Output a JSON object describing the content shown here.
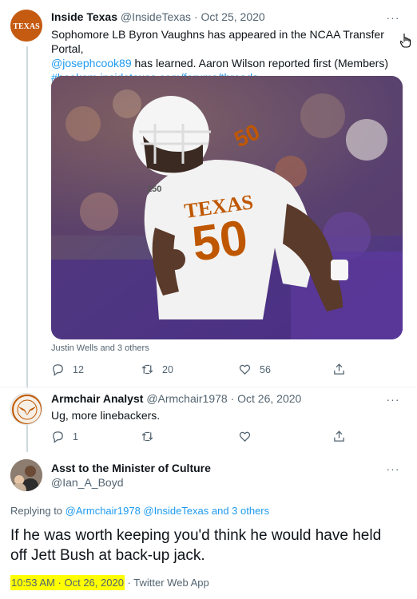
{
  "tweet1": {
    "author_name": "Inside Texas",
    "handle": "@InsideTexas",
    "separator": "·",
    "date": "Oct 25, 2020",
    "logo_text": "TEXAS",
    "more": "···",
    "text_line1": "Sophomore LB Byron Vaughns has appeared in the NCAA Transfer Portal,",
    "mention": "@josephcook89",
    "text_line2_rest": " has learned. Aaron Wilson reported first (Members)",
    "hashtag": "#hookem",
    "link": "insidetexas.com/forums/threads…",
    "media": {
      "jersey_word": "TEXAS",
      "jersey_number": "50",
      "shoulder_number": "50",
      "patch": "150"
    },
    "tagged": "Justin Wells and 3 others",
    "replies": "12",
    "retweets": "20",
    "likes": "56",
    "icons": {
      "reply": "reply-icon",
      "retweet": "retweet-icon",
      "like": "like-icon",
      "share": "share-icon"
    }
  },
  "tweet2": {
    "author_name": "Armchair Analyst",
    "handle": "@Armchair1978",
    "separator": "·",
    "date": "Oct 26, 2020",
    "more": "···",
    "text": "Ug, more linebackers.",
    "replies": "1",
    "retweets": "",
    "likes": ""
  },
  "tweet3": {
    "author_name": "Asst to the Minister of Culture",
    "handle": "@Ian_A_Boyd",
    "more": "···",
    "replying_prefix": "Replying to",
    "replying_to": "@Armchair1978 @InsideTexas and 3 others",
    "text_line1": "If he was worth keeping you'd think he would have held",
    "text_line2": "off Jett Bush at back-up jack.",
    "timestamp": "10:53 AM · Oct 26, 2020",
    "source_sep": "·",
    "source": "Twitter Web App"
  },
  "colors": {
    "accent": "#1d9bf0",
    "burnt_orange": "#c55a11",
    "highlight": "#ffff00",
    "muted": "#536471"
  }
}
